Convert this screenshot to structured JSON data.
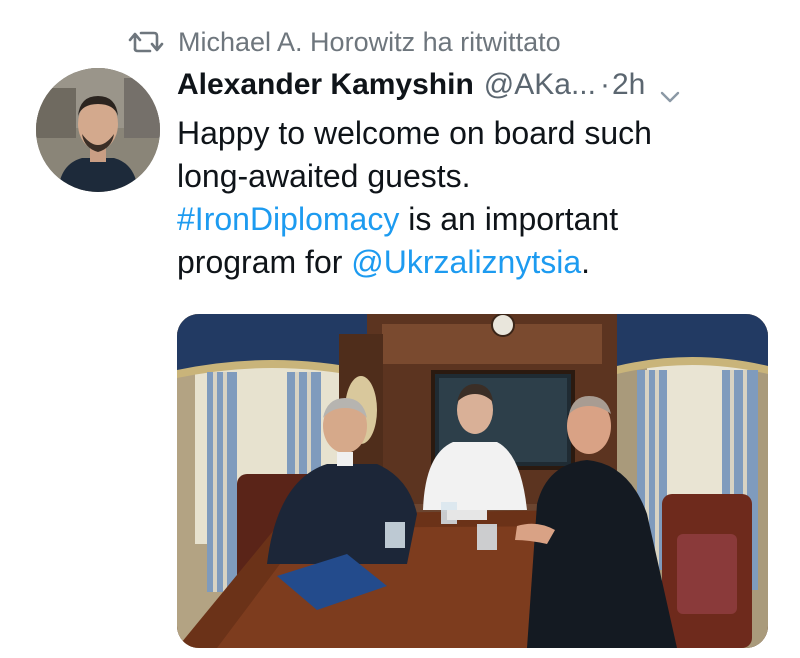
{
  "retweet": {
    "icon": "retweet-icon",
    "text": "Michael A. Horowitz ha ritwittato"
  },
  "author": {
    "display_name": "Alexander Kamyshin",
    "handle": "@AKa...",
    "separator": "·",
    "time": "2h",
    "avatar_icon": "avatar"
  },
  "tweet": {
    "line1": "Happy to welcome on board such",
    "line2": "long-awaited guests.",
    "hashtag": "#IronDiplomacy",
    "line3_rest": " is an important",
    "line4_start": "program for ",
    "mention": "@Ukrzaliznytsia",
    "line4_end": "."
  },
  "media": {
    "type": "photo",
    "icon": "photo"
  },
  "colors": {
    "link": "#1d9bf0",
    "secondary_text": "#6e767d",
    "primary_text": "#0f1419"
  }
}
